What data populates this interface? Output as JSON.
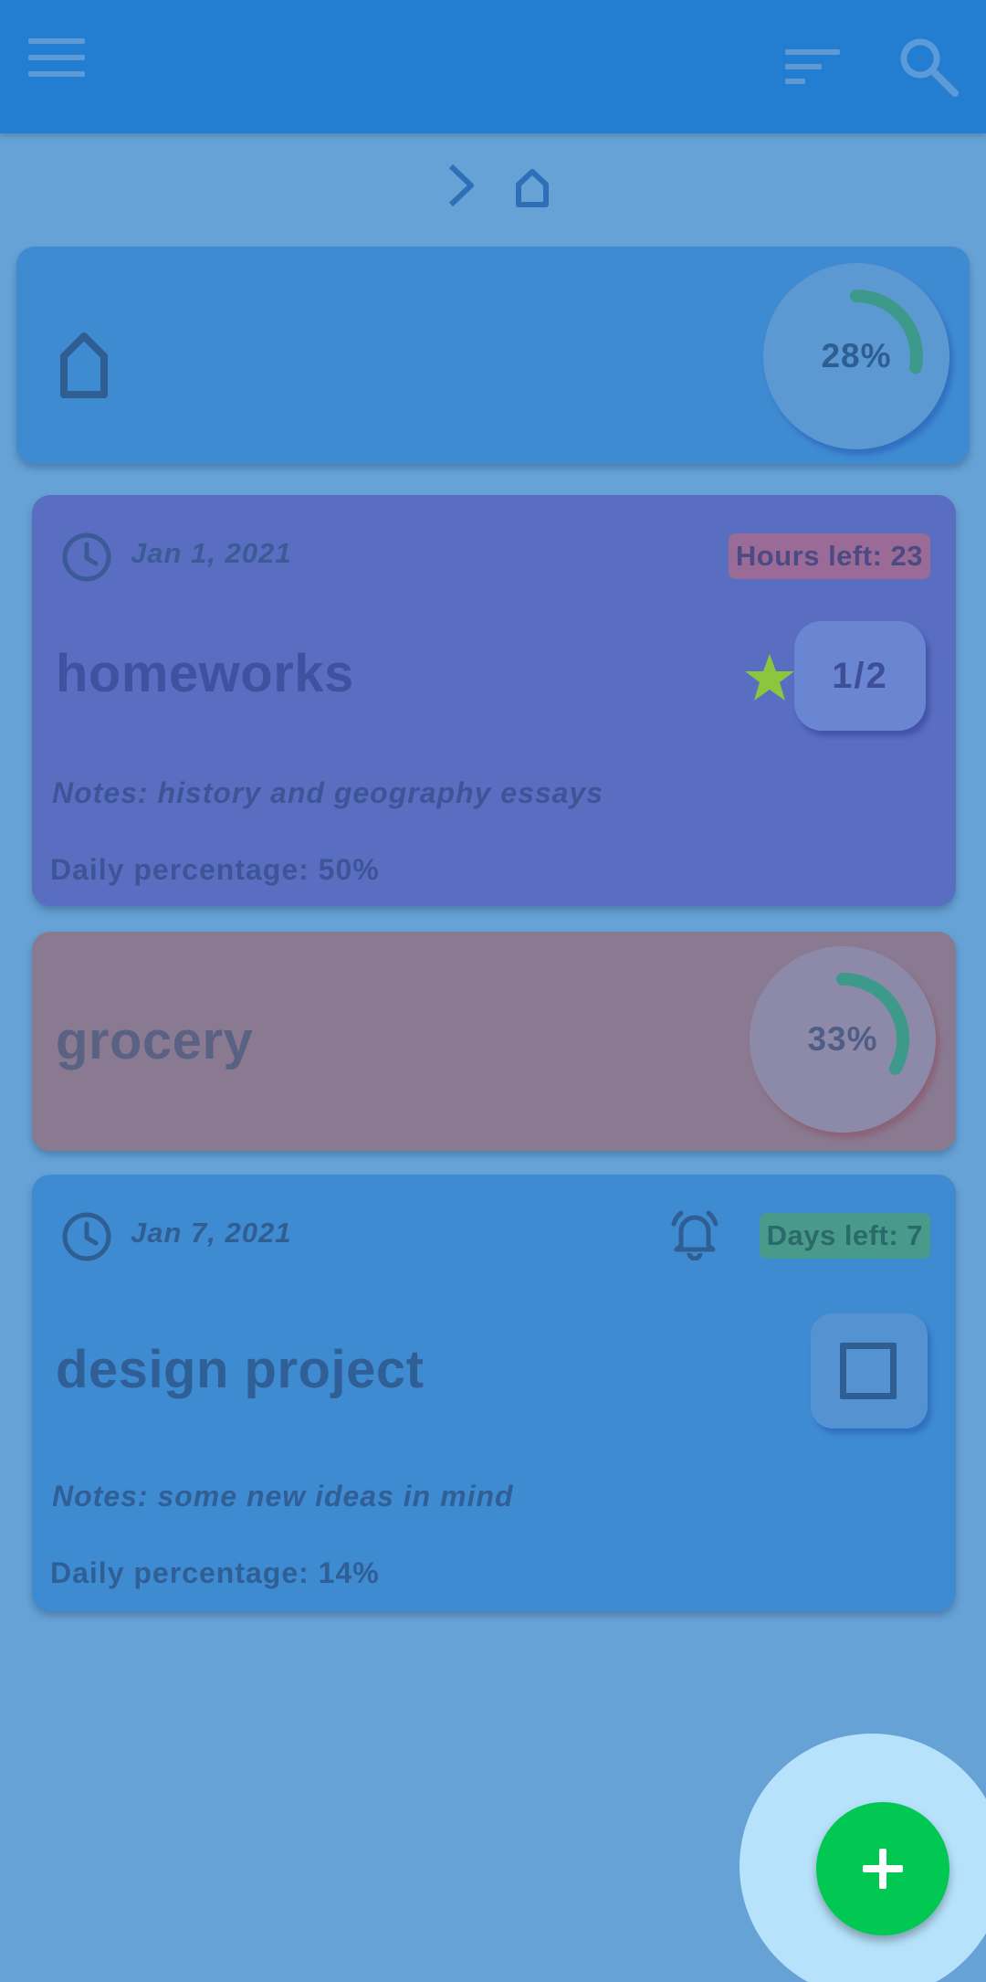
{
  "breadcrumb": {
    "chevron": "chevron-right-icon",
    "home": "home-icon"
  },
  "root": {
    "icon": "home-icon",
    "progress_label": "28%",
    "progress": 0.28
  },
  "tasks": [
    {
      "date": "Jan 1, 2021",
      "badge": "Hours left: 23",
      "title": "homeworks",
      "counter": "1/2",
      "notes": "Notes: history and geography essays",
      "daily": "Daily percentage: 50%"
    },
    {
      "title": "grocery",
      "progress_label": "33%",
      "progress": 0.33
    },
    {
      "date": "Jan 7, 2021",
      "badge": "Days left: 7",
      "title": "design project",
      "notes": "Notes: some new ideas in mind",
      "daily": "Daily percentage: 14%"
    }
  ],
  "colors": {
    "appbar": "#237dd0",
    "background": "#66a2d5",
    "card_blue": "#3f8bd2",
    "card_purple": "#596ec1",
    "card_pink": "#8a7a91",
    "fab": "#00c853",
    "star": "#8cc63f",
    "ring": "#3d9a8a"
  }
}
